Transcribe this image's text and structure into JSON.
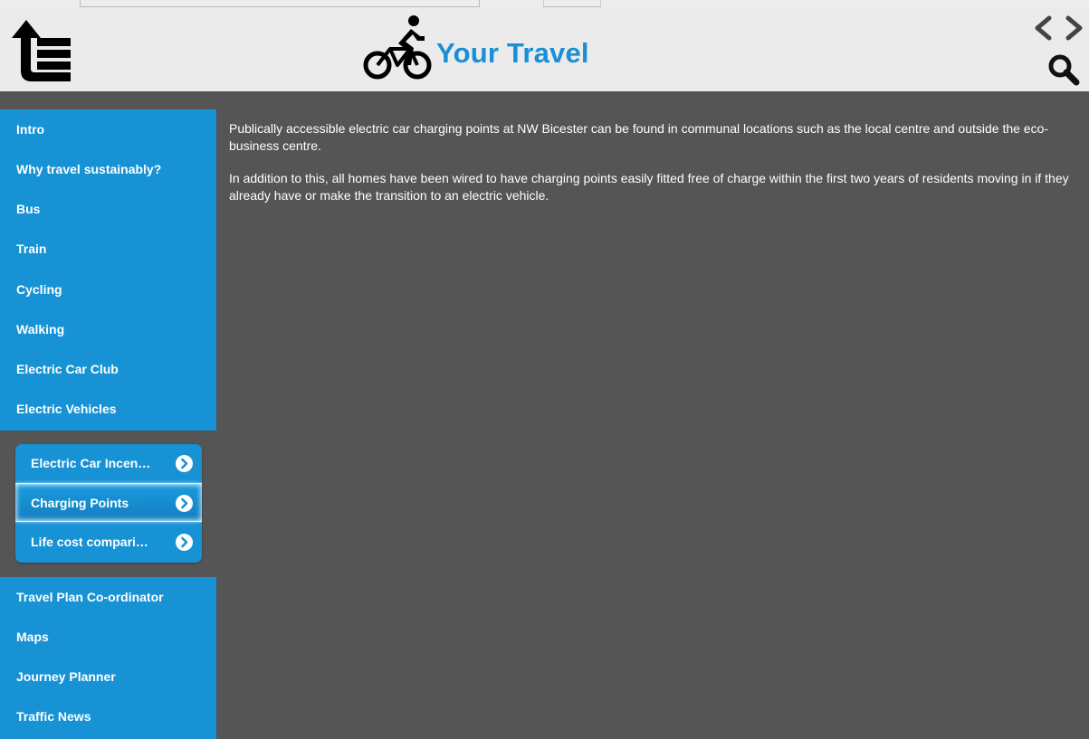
{
  "header": {
    "title": "Your Travel",
    "menu_icon": "collapse-menu-icon",
    "logo_icon": "cyclist-icon",
    "nav_icons": [
      "chevron-left-icon",
      "chevron-right-icon"
    ],
    "search_icon": "search-icon"
  },
  "colors": {
    "accent": "#1792d4",
    "title": "#1a8fd6",
    "header_bg": "#ebebeb",
    "content_bg": "#555555",
    "text": "#ffffff"
  },
  "sidebar": {
    "items": [
      {
        "label": "Intro"
      },
      {
        "label": "Why travel sustainably?"
      },
      {
        "label": "Bus"
      },
      {
        "label": "Train"
      },
      {
        "label": "Cycling"
      },
      {
        "label": "Walking"
      },
      {
        "label": "Electric Car Club"
      },
      {
        "label": "Electric Vehicles"
      },
      {
        "label": "Travel Plan Co-ordinator"
      },
      {
        "label": "Maps"
      },
      {
        "label": "Journey Planner"
      },
      {
        "label": "Traffic News"
      }
    ],
    "submenu": [
      {
        "label": "Electric Car Incen…",
        "active": false
      },
      {
        "label": "Charging Points",
        "active": true
      },
      {
        "label": "Life cost compari…",
        "active": false
      }
    ]
  },
  "content": {
    "paragraphs": [
      "Publically accessible electric car charging points at NW Bicester can be found in communal locations such as the local centre and outside the eco-business centre.",
      "In addition to this, all homes have been wired to have charging points easily fitted free of charge within the first two years of residents moving in if they already have or make the transition to an electric vehicle."
    ]
  }
}
